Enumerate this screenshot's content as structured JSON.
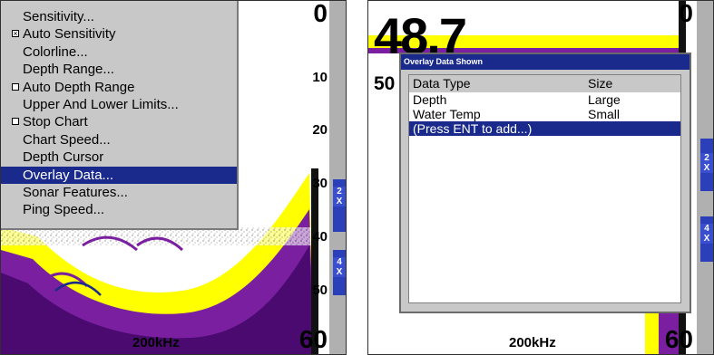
{
  "left_screen": {
    "menu_items": [
      {
        "label": "Sensitivity...",
        "checkbox": false,
        "checked": false,
        "selected": false
      },
      {
        "label": "Auto Sensitivity",
        "checkbox": true,
        "checked": true,
        "selected": false
      },
      {
        "label": "Colorline...",
        "checkbox": false,
        "checked": false,
        "selected": false
      },
      {
        "label": "Depth Range...",
        "checkbox": false,
        "checked": false,
        "selected": false
      },
      {
        "label": "Auto Depth Range",
        "checkbox": true,
        "checked": false,
        "selected": false
      },
      {
        "label": "Upper And Lower Limits...",
        "checkbox": false,
        "checked": false,
        "selected": false
      },
      {
        "label": "Stop Chart",
        "checkbox": true,
        "checked": false,
        "selected": false
      },
      {
        "label": "Chart Speed...",
        "checkbox": false,
        "checked": false,
        "selected": false
      },
      {
        "label": "Depth Cursor",
        "checkbox": false,
        "checked": false,
        "selected": false
      },
      {
        "label": "Overlay Data...",
        "checkbox": false,
        "checked": false,
        "selected": true
      },
      {
        "label": "Sonar Features...",
        "checkbox": false,
        "checked": false,
        "selected": false
      },
      {
        "label": "Ping Speed...",
        "checkbox": false,
        "checked": false,
        "selected": false
      }
    ],
    "depth_labels": [
      "0",
      "10",
      "20",
      "30",
      "40",
      "50",
      "60"
    ],
    "frequency": "200kHz",
    "zoom_labels": [
      "2\nX",
      "4\nX"
    ]
  },
  "right_screen": {
    "big_depth": "48.7",
    "side_number": "50",
    "depth_top": "0",
    "depth_bottom": "60",
    "frequency": "200kHz",
    "zoom_labels": [
      "2\nX",
      "4\nX"
    ],
    "dialog": {
      "title": "Overlay Data Shown",
      "header_type": "Data Type",
      "header_size": "Size",
      "rows": [
        {
          "type": "Depth",
          "size": "Large",
          "selected": false
        },
        {
          "type": "Water Temp",
          "size": "Small",
          "selected": false
        },
        {
          "type": "(Press ENT to add...)",
          "size": "",
          "selected": true
        }
      ]
    }
  },
  "colors": {
    "menu_bg": "#c8c8c8",
    "highlight": "#1a2a8c",
    "zoom_bar": "#2a3fb8",
    "sonar_yellow": "#ffff00",
    "sonar_purple": "#7a1fa0"
  }
}
